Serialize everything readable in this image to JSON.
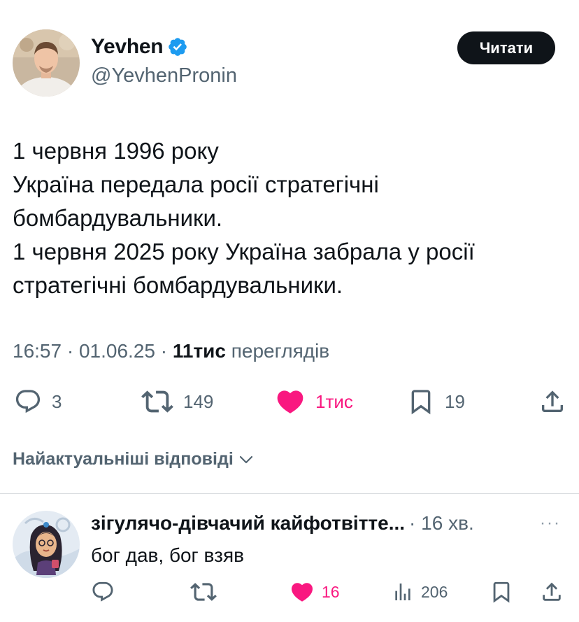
{
  "tweet": {
    "author_name": "Yevhen",
    "author_handle": "@YevhenPronin",
    "follow_label": "Читати",
    "text_lines": [
      "1 червня 1996 року",
      "Україна передала росії стратегічні",
      "бомбардувальники.",
      "1 червня 2025 року Україна забрала у росії",
      "стратегічні бомбардувальники."
    ],
    "time": "16:57",
    "date": "01.06.25",
    "separator": " · ",
    "views_count": "11тис",
    "views_label": " переглядів",
    "actions": {
      "reply_count": "3",
      "repost_count": "149",
      "like_count": "1тис",
      "bookmark_count": "19"
    }
  },
  "replies_header": "Найактуальніші відповіді",
  "reply": {
    "author_name": "зігулячо-дівчачий кайфотвітте...",
    "time": "· 16 хв.",
    "more_label": "···",
    "text": "бог дав, бог взяв",
    "actions": {
      "like_count": "16",
      "views_count": "206"
    }
  },
  "colors": {
    "text_primary": "#0f1419",
    "text_secondary": "#536471",
    "like_pink": "#f91880",
    "verified_blue": "#1d9bf0",
    "button_dark": "#0f1419"
  },
  "icons": [
    "verified-badge-icon",
    "reply-icon",
    "repost-icon",
    "like-icon",
    "bookmark-icon",
    "share-icon",
    "chevron-down-icon",
    "views-icon",
    "more-icon"
  ]
}
